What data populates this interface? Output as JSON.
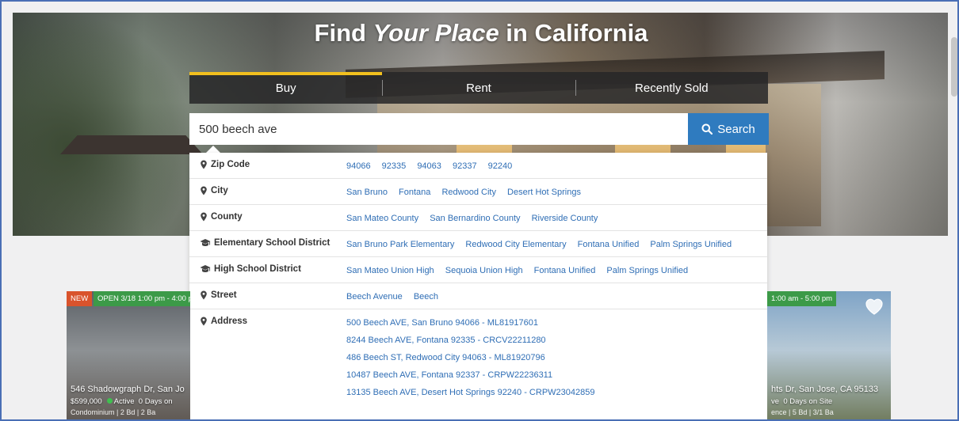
{
  "hero": {
    "title_prefix": "Find ",
    "title_emphasis": "Your Place",
    "title_suffix": " in California"
  },
  "tabs": [
    {
      "label": "Buy",
      "active": true
    },
    {
      "label": "Rent",
      "active": false
    },
    {
      "label": "Recently Sold",
      "active": false
    }
  ],
  "search": {
    "value": "500 beech ave",
    "button_label": "Search"
  },
  "suggestions": {
    "zip_code": {
      "label": "Zip Code",
      "values": [
        "94066",
        "92335",
        "94063",
        "92337",
        "92240"
      ]
    },
    "city": {
      "label": "City",
      "values": [
        "San Bruno",
        "Fontana",
        "Redwood City",
        "Desert Hot Springs"
      ]
    },
    "county": {
      "label": "County",
      "values": [
        "San Mateo County",
        "San Bernardino County",
        "Riverside County"
      ]
    },
    "elementary": {
      "label": "Elementary School District",
      "values": [
        "San Bruno Park Elementary",
        "Redwood City Elementary",
        "Fontana Unified",
        "Palm Springs Unified"
      ]
    },
    "high_school": {
      "label": "High School District",
      "values": [
        "San Mateo Union High",
        "Sequoia Union High",
        "Fontana Unified",
        "Palm Springs Unified"
      ]
    },
    "street": {
      "label": "Street",
      "values": [
        "Beech Avenue",
        "Beech"
      ]
    },
    "address": {
      "label": "Address",
      "values": [
        "500 Beech AVE, San Bruno 94066 - ML81917601",
        "8244 Beech AVE, Fontana 92335 - CRCV22211280",
        "486 Beech ST, Redwood City 94063 - ML81920796",
        "10487 Beech AVE, Fontana 92337 - CRPW22236311",
        "13135 Beech AVE, Desert Hot Springs 92240 - CRPW23042859"
      ]
    }
  },
  "cards": {
    "left": {
      "badge_new": "NEW",
      "badge_open": "OPEN 3/18 1:00 pm - 4:00 p",
      "address": "546 Shadowgraph Dr, San Jo",
      "price": "$599,000",
      "status": "Active",
      "days": "0 Days on",
      "sub": "Condominium | 2 Bd | 2 Ba"
    },
    "right": {
      "badge_open": "1:00 am - 5:00 pm",
      "address": "hts Dr, San Jose, CA 95133",
      "status_tail": "ve",
      "days": "0 Days on Site",
      "sub": "ence | 5 Bd | 3/1 Ba"
    }
  },
  "colors": {
    "accent_tab": "#f2c01e",
    "search_button": "#2f7bbf",
    "link": "#2f6eb5"
  }
}
